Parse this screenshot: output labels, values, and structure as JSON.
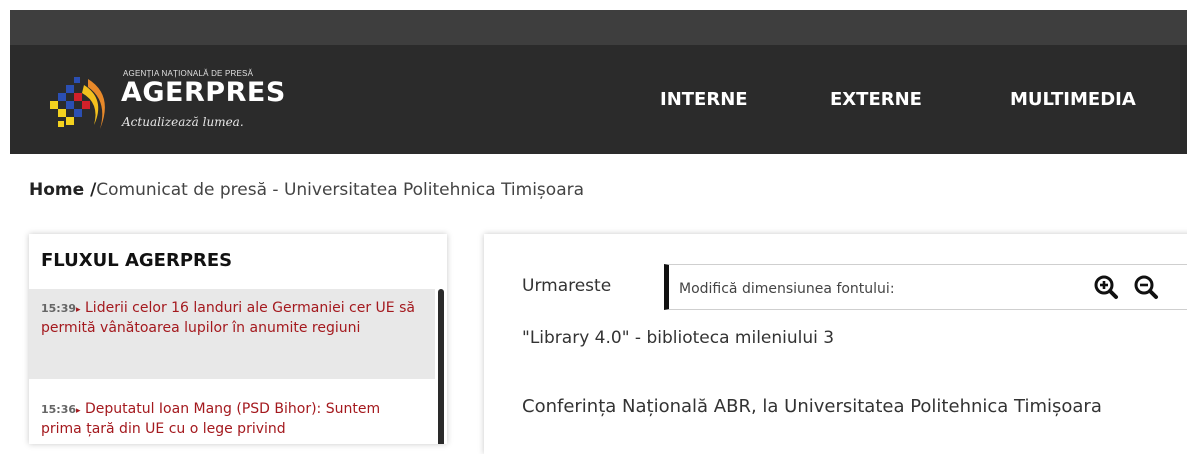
{
  "header": {
    "logo_small": "AGENȚIA NAȚIONALĂ DE PRESĂ",
    "logo_main": "AGERPRES",
    "logo_tagline": "Actualizează lumea.",
    "nav": [
      "INTERNE",
      "EXTERNE",
      "MULTIMEDIA"
    ]
  },
  "breadcrumb": {
    "home": "Home /",
    "current": "Comunicat de presă - Universitatea Politehnica Timișoara"
  },
  "feed": {
    "title": "FLUXUL AGERPRES",
    "items": [
      {
        "time": "15:39",
        "text": "Liderii celor 16 landuri ale Germaniei cer UE să permită vânătoarea lupilor în anumite regiuni"
      },
      {
        "time": "15:36",
        "text": "Deputatul Ioan Mang (PSD Bihor): Suntem prima țară din UE cu o lege privind"
      }
    ]
  },
  "article": {
    "follow_label": "Urmareste",
    "font_label": "Modifică dimensiunea fontului:",
    "lead": "\"Library 4.0\" - biblioteca mileniului 3",
    "subhead": "Conferința Națională ABR, la Universitatea Politehnica Timișoara"
  },
  "icons": {
    "zoom_in": "zoom-in-icon",
    "zoom_out": "zoom-out-icon",
    "arrow": "triangle-right-icon"
  },
  "colors": {
    "header_bg": "#2b2b2b",
    "feed_link": "#a4191e",
    "feed_active_bg": "#e8e8e8"
  }
}
